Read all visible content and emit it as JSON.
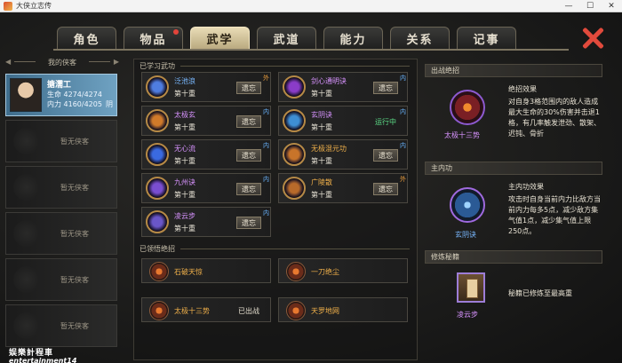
{
  "window": {
    "title": "大侠立志传"
  },
  "tabs": [
    {
      "label": "角色"
    },
    {
      "label": "物品",
      "has_notice": true
    },
    {
      "label": "武学",
      "active": true
    },
    {
      "label": "武道"
    },
    {
      "label": "能力"
    },
    {
      "label": "关系"
    },
    {
      "label": "记事"
    }
  ],
  "roster": {
    "header": "我的侠客",
    "hero": {
      "name": "搪濡工",
      "hp_label": "生命 4274/4274",
      "mp_label": "内力 4160/4205",
      "alignment": "阴"
    },
    "empty_label": "暂无侠客",
    "empty_slots": [
      "暂无侠客",
      "暂无侠客",
      "暂无侠客",
      "暂无侠客",
      "暂无侠客"
    ]
  },
  "learned": {
    "header": "已学习武功",
    "skills": [
      {
        "name": "泛池浪",
        "level": "第十重",
        "action": "遗忘",
        "tag": "外",
        "name_color": "#79b8ff",
        "icon_color": "#4f7de0"
      },
      {
        "name": "剑心通明诀",
        "level": "第十重",
        "action": "遗忘",
        "tag": "内",
        "name_color": "#d893ff",
        "icon_color": "#8a3cc8"
      },
      {
        "name": "太极玄",
        "level": "第十重",
        "action": "遗忘",
        "tag": "内",
        "name_color": "#d893ff",
        "icon_color": "#d07a2a"
      },
      {
        "name": "玄阴诀",
        "level": "第十重",
        "status": "运行中",
        "tag": "内",
        "name_color": "#d893ff",
        "icon_color": "#3e8fd4"
      },
      {
        "name": "无心流",
        "level": "第十重",
        "action": "遗忘",
        "tag": "内",
        "name_color": "#d893ff",
        "icon_color": "#3a6ae0"
      },
      {
        "name": "无极混元功",
        "level": "第十重",
        "action": "遗忘",
        "tag": "内",
        "name_color": "#f0b04a",
        "icon_color": "#c8742a"
      },
      {
        "name": "九州诀",
        "level": "第十重",
        "action": "遗忘",
        "tag": "内",
        "name_color": "#d893ff",
        "icon_color": "#7a4ed0"
      },
      {
        "name": "广陵散",
        "level": "第十重",
        "action": "遗忘",
        "tag": "外",
        "name_color": "#f0b04a",
        "icon_color": "#b86a2a"
      },
      {
        "name": "凌云步",
        "level": "第十重",
        "action": "遗忘",
        "tag": "内",
        "name_color": "#d893ff",
        "icon_color": "#6a56c8"
      }
    ]
  },
  "ultimates": {
    "header": "已领悟绝招",
    "items": [
      {
        "name": "石破天惊",
        "status": ""
      },
      {
        "name": "一刀绝尘",
        "status": ""
      },
      {
        "name": "太极十三势",
        "status": "已出战"
      },
      {
        "name": "天罗地网",
        "status": ""
      }
    ]
  },
  "right": {
    "battle": {
      "header": "出战绝招",
      "icon_name": "太极十三势",
      "effect_title": "绝招效果",
      "effect_text": "对自身3格范围内的敌人造成最大生命的30%伤害并击退1格，有几率触发泄劲、散架、迟钝、骨折"
    },
    "internal": {
      "header": "主内功",
      "icon_name": "玄阴诀",
      "effect_title": "主内功效果",
      "effect_text": "攻击时自身当前内力比敌方当前内力每多5点，减少敌方集气值1点，减少集气值上限250点。"
    },
    "manual": {
      "header": "修炼秘籍",
      "icon_name": "凌云步",
      "note": "秘籍已修炼至最高重"
    }
  },
  "watermark": {
    "line1": "娱樂計程車",
    "line2": "entertainment14"
  },
  "colors": {
    "accent_gold": "#f0b04a",
    "accent_purple": "#d893ff",
    "accent_blue": "#79b8ff",
    "running_green": "#5cdc87",
    "close_red": "#e14a3c"
  }
}
